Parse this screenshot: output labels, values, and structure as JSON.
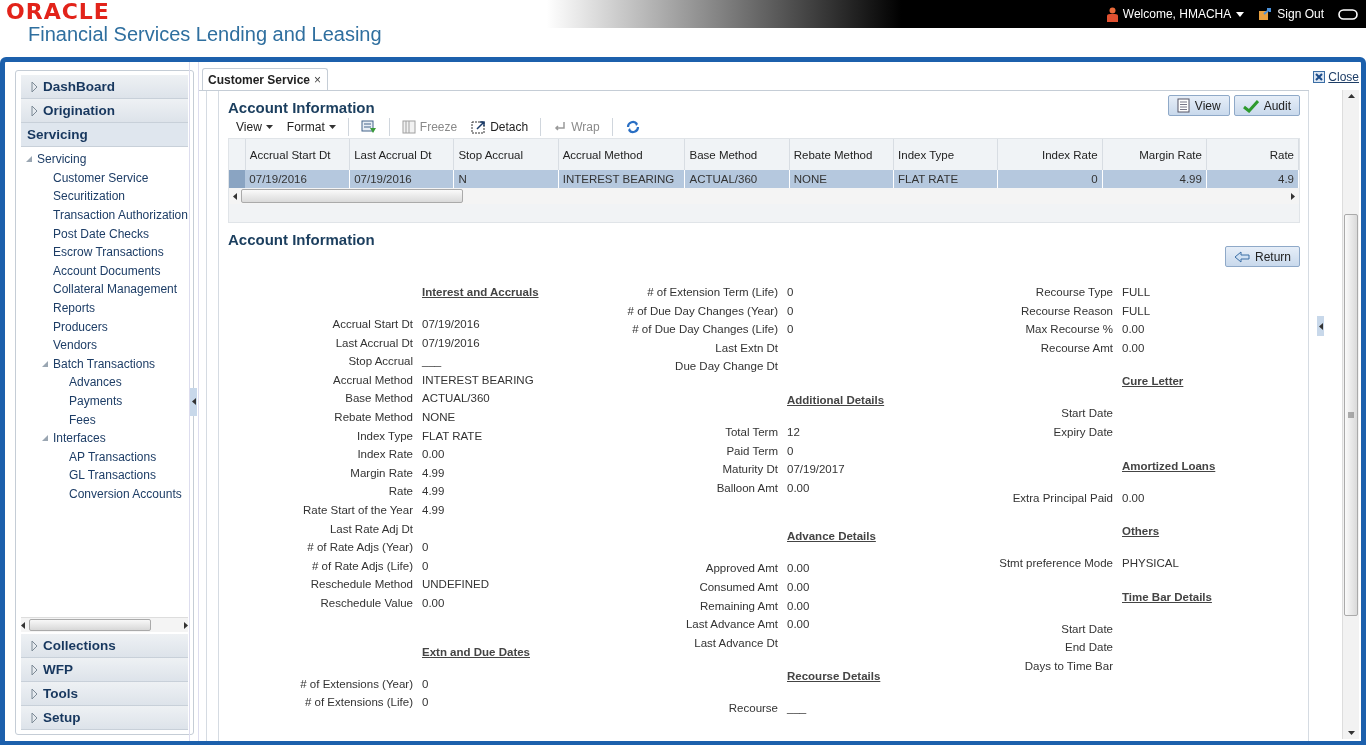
{
  "header": {
    "brand": "ORACLE",
    "product": "Financial Services Lending and Leasing",
    "welcome": "Welcome, HMACHA",
    "sign_out": "Sign Out"
  },
  "sidebar": {
    "sections": [
      {
        "label": "DashBoard",
        "expanded": false
      },
      {
        "label": "Origination",
        "expanded": false
      },
      {
        "label": "Servicing",
        "expanded": true,
        "tree": [
          {
            "label": "Servicing",
            "expanded": true,
            "children": [
              {
                "label": "Customer Service"
              },
              {
                "label": "Securitization"
              },
              {
                "label": "Transaction Authorization"
              },
              {
                "label": "Post Date Checks"
              },
              {
                "label": "Escrow Transactions"
              },
              {
                "label": "Account Documents"
              },
              {
                "label": "Collateral Management"
              },
              {
                "label": "Reports"
              },
              {
                "label": "Producers"
              },
              {
                "label": "Vendors"
              },
              {
                "label": "Batch Transactions",
                "expanded": true,
                "children": [
                  {
                    "label": "Advances"
                  },
                  {
                    "label": "Payments"
                  },
                  {
                    "label": "Fees"
                  }
                ]
              },
              {
                "label": "Interfaces",
                "expanded": true,
                "children": [
                  {
                    "label": "AP Transactions"
                  },
                  {
                    "label": "GL Transactions"
                  },
                  {
                    "label": "Conversion Accounts"
                  }
                ]
              }
            ]
          }
        ]
      },
      {
        "label": "Collections",
        "expanded": false
      },
      {
        "label": "WFP",
        "expanded": false
      },
      {
        "label": "Tools",
        "expanded": false
      },
      {
        "label": "Setup",
        "expanded": false
      }
    ]
  },
  "close": "Close",
  "tabs": [
    {
      "label": "Customer Service",
      "selected": true,
      "close": "×"
    }
  ],
  "table": {
    "title": "Account Information",
    "actions": [
      {
        "label": "View",
        "kind": "view"
      },
      {
        "label": "Audit",
        "kind": "audit"
      }
    ],
    "toolbar": [
      {
        "label": "View",
        "kind": "menu"
      },
      {
        "label": "Format",
        "kind": "menu"
      },
      {
        "kind": "filter"
      },
      {
        "label": "Freeze",
        "kind": "freeze",
        "disabled": true
      },
      {
        "label": "Detach",
        "kind": "detach",
        "disabled": false
      },
      {
        "label": "Wrap",
        "kind": "wrap",
        "disabled": true
      },
      {
        "kind": "refresh"
      }
    ],
    "columns": [
      {
        "label": "Accrual Start Dt",
        "kind": "text"
      },
      {
        "label": "Last Accrual Dt",
        "kind": "text"
      },
      {
        "label": "Stop Accrual",
        "kind": "text"
      },
      {
        "label": "Accrual Method",
        "kind": "text"
      },
      {
        "label": "Base Method",
        "kind": "text"
      },
      {
        "label": "Rebate Method",
        "kind": "text"
      },
      {
        "label": "Index Type",
        "kind": "text"
      },
      {
        "label": "Index Rate",
        "kind": "number"
      },
      {
        "label": "Margin Rate",
        "kind": "number"
      },
      {
        "label": "Rate",
        "kind": "number"
      }
    ],
    "rows": [
      {
        "selected": true,
        "cells": [
          "07/19/2016",
          "07/19/2016",
          "N",
          "INTEREST BEARING",
          "ACTUAL/360",
          "NONE",
          "FLAT RATE",
          "0",
          "4.99",
          "4.9"
        ]
      }
    ]
  },
  "details": {
    "title": "Account Information",
    "return": "Return",
    "columns": [
      [
        {
          "kind": "heading",
          "text": "Interest and Accruals"
        },
        {
          "kind": "field",
          "label": "Accrual Start Dt",
          "value": "07/19/2016"
        },
        {
          "kind": "field",
          "label": "Last Accrual Dt",
          "value": "07/19/2016"
        },
        {
          "kind": "field",
          "label": "Stop Accrual",
          "value": "___"
        },
        {
          "kind": "field",
          "label": "Accrual Method",
          "value": "INTEREST BEARING"
        },
        {
          "kind": "field",
          "label": "Base Method",
          "value": "ACTUAL/360"
        },
        {
          "kind": "field",
          "label": "Rebate Method",
          "value": "NONE"
        },
        {
          "kind": "field",
          "label": "Index Type",
          "value": "FLAT RATE"
        },
        {
          "kind": "field",
          "label": "Index Rate",
          "value": "0.00"
        },
        {
          "kind": "field",
          "label": "Margin Rate",
          "value": "4.99"
        },
        {
          "kind": "field",
          "label": "Rate",
          "value": "4.99"
        },
        {
          "kind": "field",
          "label": "Rate Start of the Year",
          "value": "4.99"
        },
        {
          "kind": "field",
          "label": "Last Rate Adj Dt"
        },
        {
          "kind": "field",
          "label": "# of Rate Adjs (Year)",
          "value": "0"
        },
        {
          "kind": "field",
          "label": "# of Rate Adjs (Life)",
          "value": "0"
        },
        {
          "kind": "field",
          "label": "Reschedule Method",
          "value": "UNDEFINED"
        },
        {
          "kind": "field",
          "label": "Reschedule Value",
          "value": "0.00"
        },
        {
          "kind": "gap"
        },
        {
          "kind": "heading",
          "text": "Extn and Due Dates"
        },
        {
          "kind": "field",
          "label": "# of Extensions (Year)",
          "value": "0"
        },
        {
          "kind": "field",
          "label": "# of Extensions (Life)",
          "value": "0"
        }
      ],
      [
        {
          "kind": "field",
          "label": "# of Extension Term (Life)",
          "value": "0"
        },
        {
          "kind": "field",
          "label": "# of Due Day Changes (Year)",
          "value": "0"
        },
        {
          "kind": "field",
          "label": "# of Due Day Changes (Life)",
          "value": "0"
        },
        {
          "kind": "field",
          "label": "Last Extn Dt"
        },
        {
          "kind": "field",
          "label": "Due Day Change Dt"
        },
        {
          "kind": "heading",
          "text": "Additional Details"
        },
        {
          "kind": "field",
          "label": "Total Term",
          "value": "12"
        },
        {
          "kind": "field",
          "label": "Paid Term",
          "value": "0"
        },
        {
          "kind": "field",
          "label": "Maturity Dt",
          "value": "07/19/2017"
        },
        {
          "kind": "field",
          "label": "Balloon Amt",
          "value": "0.00"
        },
        {
          "kind": "gap"
        },
        {
          "kind": "heading",
          "text": "Advance Details"
        },
        {
          "kind": "field",
          "label": "Approved Amt",
          "value": "0.00"
        },
        {
          "kind": "field",
          "label": "Consumed Amt",
          "value": "0.00"
        },
        {
          "kind": "field",
          "label": "Remaining Amt",
          "value": "0.00"
        },
        {
          "kind": "field",
          "label": "Last Advance Amt",
          "value": "0.00"
        },
        {
          "kind": "field",
          "label": "Last Advance Dt"
        },
        {
          "kind": "heading",
          "text": "Recourse Details"
        },
        {
          "kind": "field",
          "label": "Recourse",
          "value": "___"
        }
      ],
      [
        {
          "kind": "field",
          "label": "Recourse Type",
          "value": "FULL"
        },
        {
          "kind": "field",
          "label": "Recourse Reason",
          "value": "FULL"
        },
        {
          "kind": "field",
          "label": "Max Recourse %",
          "value": "0.00"
        },
        {
          "kind": "field",
          "label": "Recourse Amt",
          "value": "0.00"
        },
        {
          "kind": "heading",
          "text": "Cure Letter"
        },
        {
          "kind": "field",
          "label": "Start Date"
        },
        {
          "kind": "field",
          "label": "Expiry Date"
        },
        {
          "kind": "heading",
          "text": "Amortized Loans"
        },
        {
          "kind": "field",
          "label": "Extra Principal Paid",
          "value": "0.00"
        },
        {
          "kind": "heading",
          "text": "Others"
        },
        {
          "kind": "field",
          "label": "Stmt preference Mode",
          "value": "PHYSICAL"
        },
        {
          "kind": "heading",
          "text": "Time Bar Details"
        },
        {
          "kind": "field",
          "label": "Start Date"
        },
        {
          "kind": "field",
          "label": "End Date"
        },
        {
          "kind": "field",
          "label": "Days to Time Bar"
        }
      ]
    ]
  }
}
